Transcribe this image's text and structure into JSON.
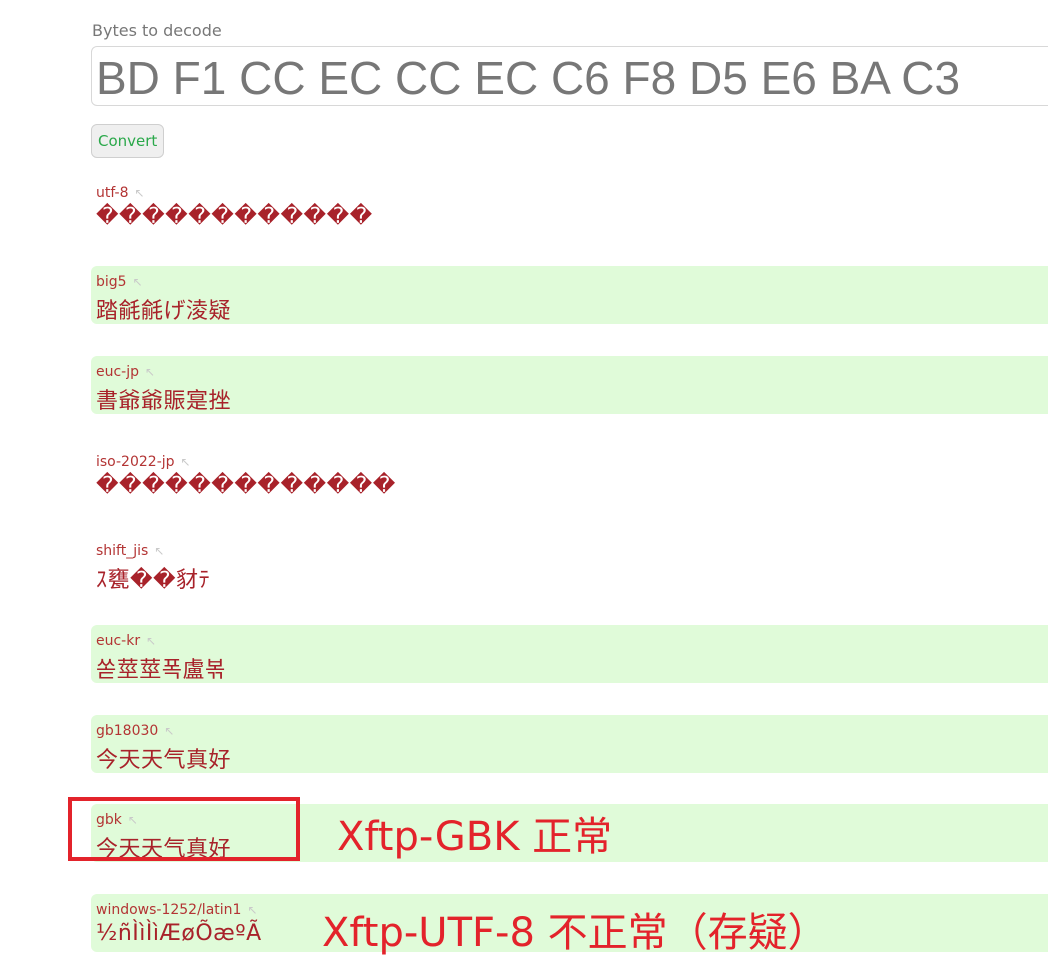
{
  "form": {
    "bytes_label": "Bytes to decode",
    "bytes_value": "BD F1 CC EC CC EC C6 F8 D5 E6 BA C3",
    "convert_label": "Convert"
  },
  "link_arrow": "↖",
  "results": [
    {
      "encoding": "utf-8",
      "decoded": "������������",
      "highlighted": false
    },
    {
      "encoding": "big5",
      "decoded": "踏毹毹げ淩疑",
      "highlighted": true
    },
    {
      "encoding": "euc-jp",
      "decoded": "書爺爺賑寔挫",
      "highlighted": true
    },
    {
      "encoding": "iso-2022-jp",
      "decoded": "�������������",
      "highlighted": false
    },
    {
      "encoding": "shift_jis",
      "decoded": "ｽ甕��豺ﾃ",
      "highlighted": false
    },
    {
      "encoding": "euc-kr",
      "decoded": "쏟莖莖폭盧볶",
      "highlighted": true
    },
    {
      "encoding": "gb18030",
      "decoded": "今天天气真好",
      "highlighted": true
    },
    {
      "encoding": "gbk",
      "decoded": "今天天气真好",
      "highlighted": true
    },
    {
      "encoding": "windows-1252/latin1",
      "decoded": "½ñÌìÌìÆøÕæºÃ",
      "highlighted": true
    }
  ],
  "annotations": {
    "gbk_note": "Xftp-GBK 正常",
    "latin_note": "Xftp-UTF-8 不正常（存疑）",
    "color": "#e3232b"
  },
  "colors": {
    "highlight_bg": "#e0fbd9",
    "decoded_text": "#a8222a",
    "convert_text": "#2aa84a"
  }
}
